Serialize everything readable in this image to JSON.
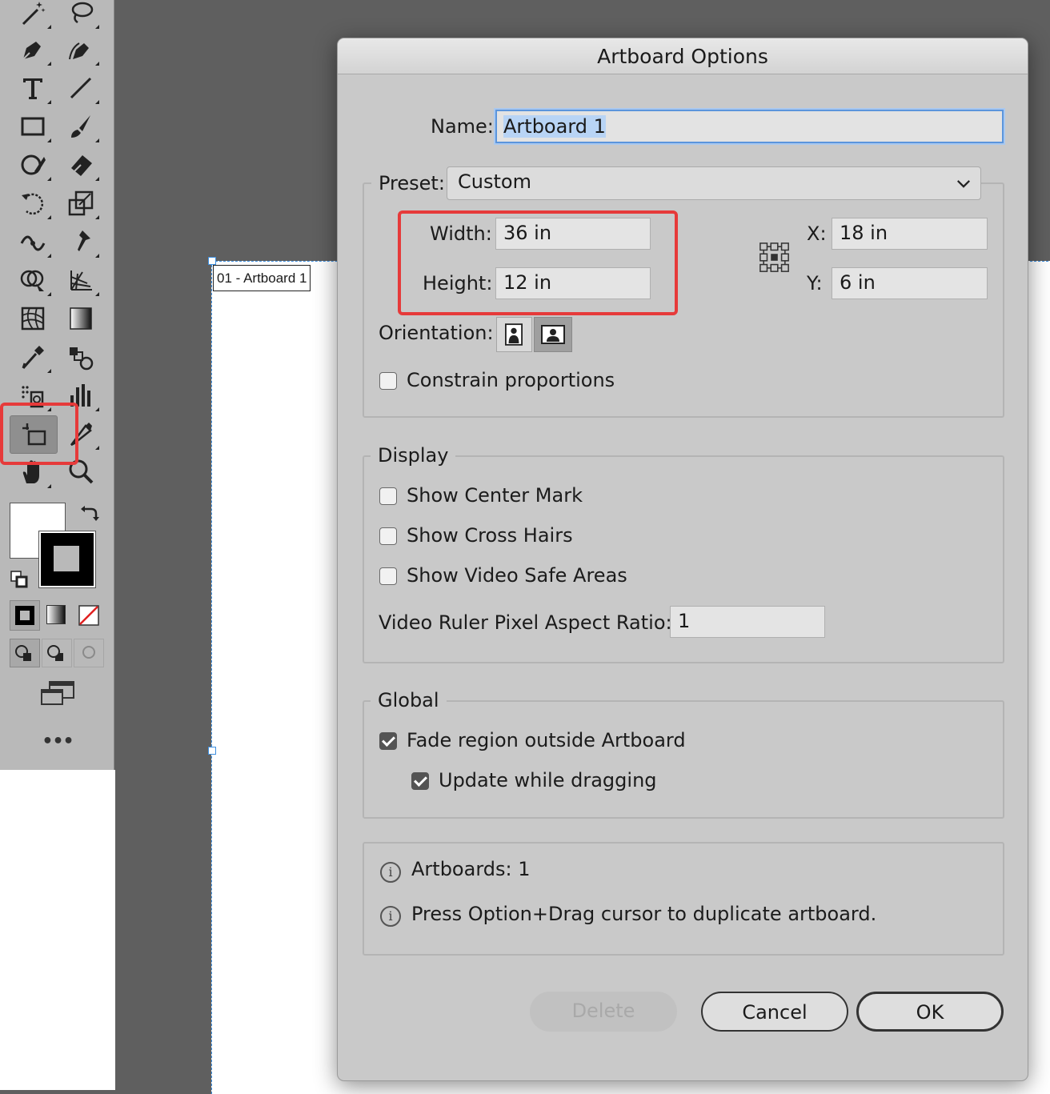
{
  "canvas": {
    "artboard_label": "01 - Artboard 1"
  },
  "toolbar": {
    "tools": [
      {
        "name": "magic-wand-tool-icon"
      },
      {
        "name": "lasso-tool-icon"
      },
      {
        "name": "pen-tool-icon"
      },
      {
        "name": "curvature-tool-icon"
      },
      {
        "name": "type-tool-icon"
      },
      {
        "name": "line-segment-tool-icon"
      },
      {
        "name": "rectangle-tool-icon"
      },
      {
        "name": "paintbrush-tool-icon"
      },
      {
        "name": "shaper-tool-icon"
      },
      {
        "name": "eraser-tool-icon"
      },
      {
        "name": "rotate-tool-icon"
      },
      {
        "name": "scale-tool-icon"
      },
      {
        "name": "width-tool-icon"
      },
      {
        "name": "puppet-warp-tool-icon"
      },
      {
        "name": "shape-builder-tool-icon"
      },
      {
        "name": "perspective-grid-tool-icon"
      },
      {
        "name": "mesh-tool-icon"
      },
      {
        "name": "gradient-tool-icon"
      },
      {
        "name": "eyedropper-tool-icon"
      },
      {
        "name": "blend-tool-icon"
      },
      {
        "name": "symbol-sprayer-tool-icon"
      },
      {
        "name": "column-graph-tool-icon"
      },
      {
        "name": "artboard-tool-icon"
      },
      {
        "name": "slice-tool-icon"
      },
      {
        "name": "hand-tool-icon"
      },
      {
        "name": "zoom-tool-icon"
      }
    ],
    "active_tool": "artboard-tool-icon",
    "more_label": "•••"
  },
  "dialog": {
    "title": "Artboard Options",
    "name_label": "Name:",
    "name_value": "Artboard 1",
    "preset_label": "Preset:",
    "preset_value": "Custom",
    "width_label": "Width:",
    "width_value": "36 in",
    "height_label": "Height:",
    "height_value": "12 in",
    "x_label": "X:",
    "x_value": "18 in",
    "y_label": "Y:",
    "y_value": "6 in",
    "orientation_label": "Orientation:",
    "orientation_selected": "landscape",
    "constrain_label": "Constrain proportions",
    "constrain_checked": false,
    "display": {
      "legend": "Display",
      "show_center_mark": "Show Center Mark",
      "show_cross_hairs": "Show Cross Hairs",
      "show_video_safe": "Show Video Safe Areas",
      "pixel_aspect_label": "Video Ruler Pixel Aspect Ratio:",
      "pixel_aspect_value": "1"
    },
    "global": {
      "legend": "Global",
      "fade_label": "Fade region outside Artboard",
      "fade_checked": true,
      "update_label": "Update while dragging",
      "update_checked": true
    },
    "info": {
      "artboards": "Artboards: 1",
      "tip": "Press Option+Drag cursor to duplicate artboard."
    },
    "buttons": {
      "delete": "Delete",
      "cancel": "Cancel",
      "ok": "OK"
    }
  },
  "colors": {
    "highlight_red": "#e63a3a",
    "focus_blue": "#3d8fe0",
    "selection_blue": "#b8d4f5"
  }
}
